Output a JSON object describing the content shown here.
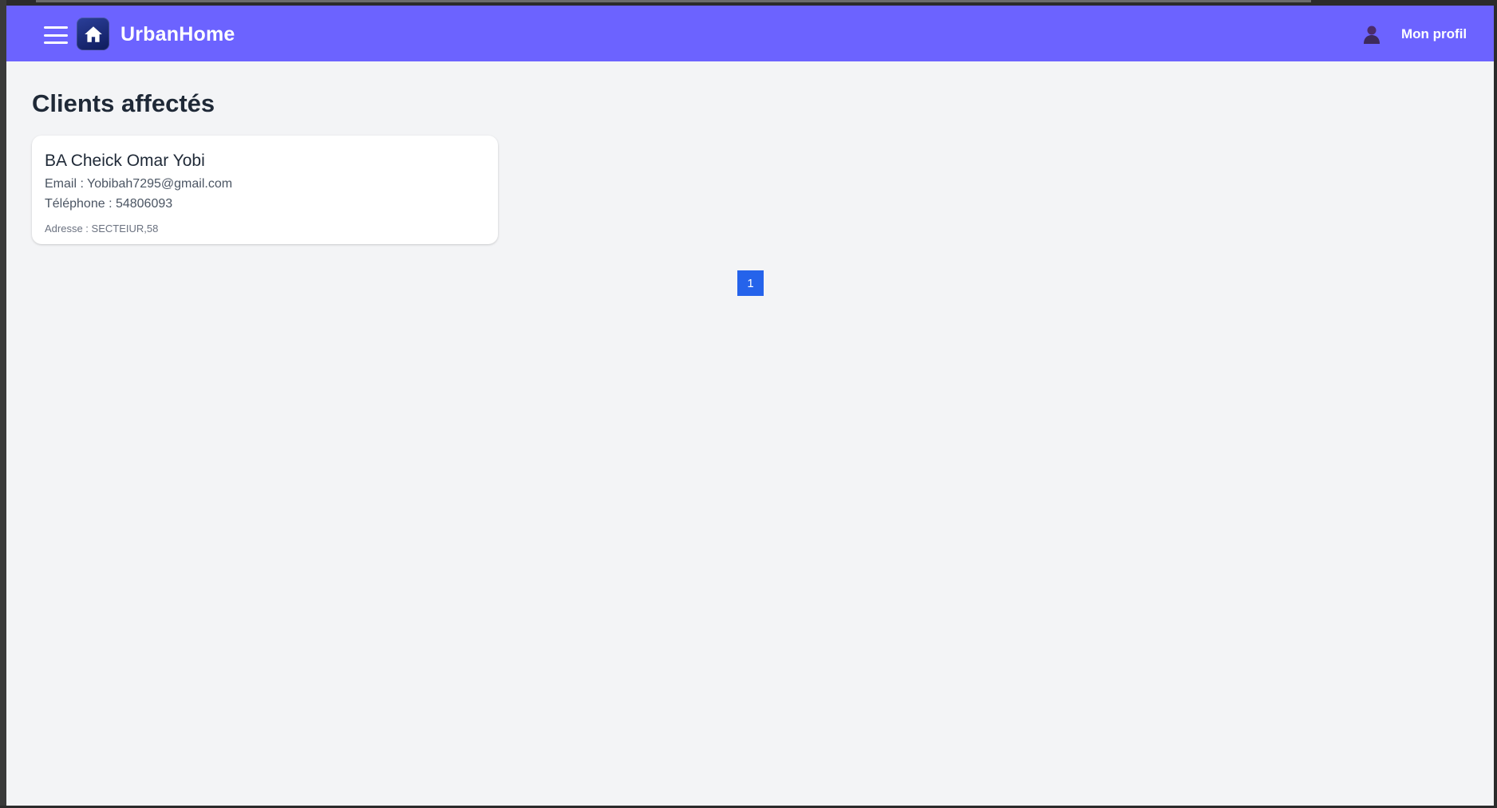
{
  "app": {
    "brand": "UrbanHome",
    "accent_color": "#6c63ff",
    "menu_icon": "hamburger-icon",
    "logo_icon": "house-icon"
  },
  "header": {
    "profile_label": "Mon profil",
    "profile_icon": "user-icon"
  },
  "main": {
    "title": "Clients affectés",
    "clients": [
      {
        "name": "BA Cheick Omar Yobi",
        "email": "Email : Yobibah7295@gmail.com",
        "phone": "Téléphone : 54806093",
        "address": "Adresse : SECTEIUR,58"
      }
    ]
  },
  "pagination": {
    "pages": [
      "1"
    ],
    "current": "1",
    "active_color": "#2563eb"
  }
}
